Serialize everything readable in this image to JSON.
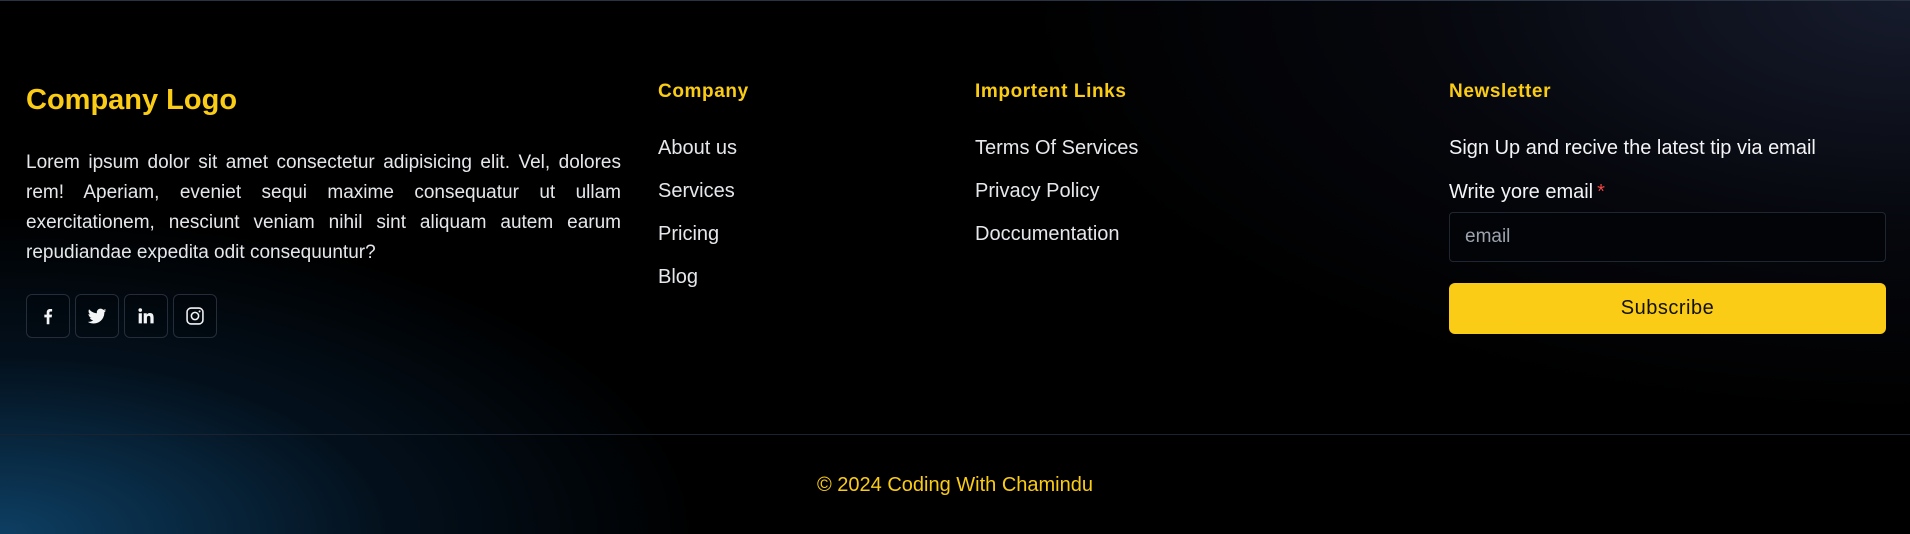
{
  "about": {
    "logo": "Company Logo",
    "description": "Lorem ipsum dolor sit amet consectetur adipisicing elit. Vel, dolores rem! Aperiam, eveniet sequi maxime consequatur ut ullam exercitationem, nesciunt veniam nihil sint aliquam autem earum repudiandae expedita odit consequuntur?",
    "socials": [
      {
        "icon": "facebook-icon"
      },
      {
        "icon": "twitter-icon"
      },
      {
        "icon": "linkedin-icon"
      },
      {
        "icon": "instagram-icon"
      }
    ]
  },
  "company": {
    "heading": "Company",
    "links": [
      "About us",
      "Services",
      "Pricing",
      "Blog"
    ]
  },
  "important_links": {
    "heading": "Importent Links",
    "links": [
      "Terms Of Services",
      "Privacy Policy",
      "Doccumentation"
    ]
  },
  "newsletter": {
    "heading": "Newsletter",
    "description": "Sign Up and recive the latest tip via email",
    "field_label": "Write yore email",
    "required_mark": "*",
    "email_placeholder": "email",
    "subscribe_label": "Subscribe"
  },
  "footer": {
    "copyright": "© 2024 Coding With Chamindu"
  },
  "colors": {
    "accent": "#facc15",
    "required": "#ef4444",
    "background": "#000000"
  }
}
